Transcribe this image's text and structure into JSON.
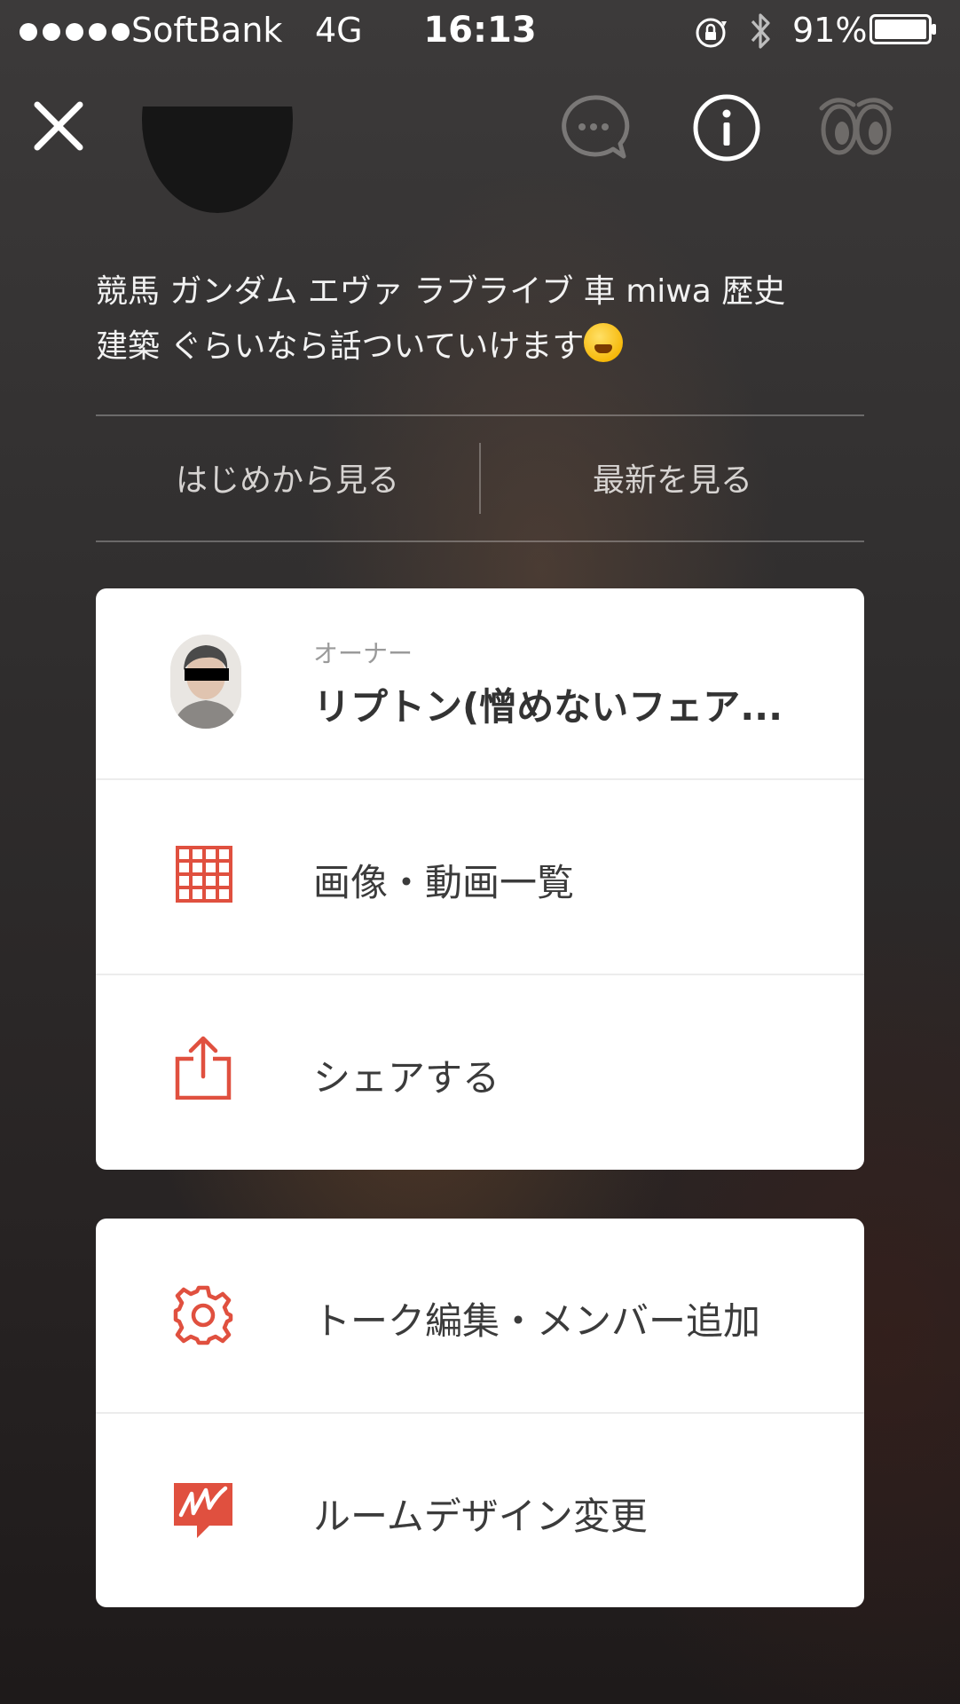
{
  "status_bar": {
    "carrier": "SoftBank",
    "network": "4G",
    "time": "16:13",
    "battery": "91%"
  },
  "nav": {
    "close_icon": "close-icon",
    "chat_icon": "chat-bubble-icon",
    "info_icon": "info-icon",
    "eyes_icon": "eyes-icon"
  },
  "room": {
    "description_line1": "競馬 ガンダム エヴァ ラブライブ  車 miwa 歴史",
    "description_line2": "建築 ぐらいなら話ついていけます"
  },
  "view_options": {
    "from_start": "はじめから見る",
    "latest": "最新を見る"
  },
  "owner": {
    "role": "オーナー",
    "name": "リプトン(憎めないフェア..."
  },
  "menu": {
    "media_list": "画像・動画一覧",
    "share": "シェアする",
    "edit_talk": "トーク編集・メンバー追加",
    "room_design": "ルームデザイン変更"
  },
  "colors": {
    "accent": "#e0503f",
    "card_bg": "#ffffff"
  }
}
